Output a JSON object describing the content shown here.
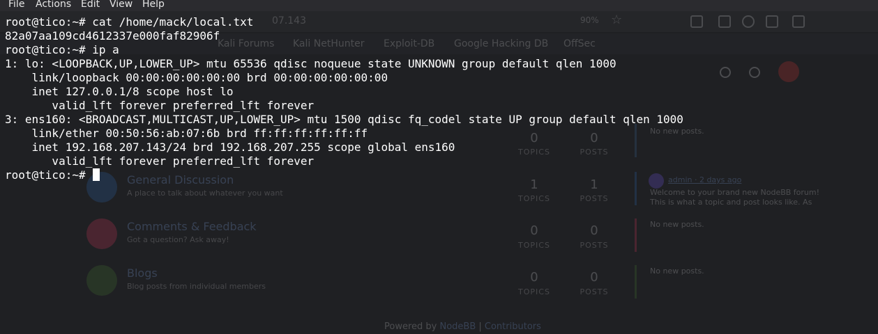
{
  "menu": [
    "File",
    "Actions",
    "Edit",
    "View",
    "Help"
  ],
  "terminal": {
    "lines": [
      "root@tico:~# cat /home/mack/local.txt",
      "82a07aa109cd4612337e000faf82906f",
      "root@tico:~# ip a",
      "1: lo: <LOOPBACK,UP,LOWER_UP> mtu 65536 qdisc noqueue state UNKNOWN group default qlen 1000",
      "    link/loopback 00:00:00:00:00:00 brd 00:00:00:00:00:00",
      "    inet 127.0.0.1/8 scope host lo",
      "       valid_lft forever preferred_lft forever",
      "3: ens160: <BROADCAST,MULTICAST,UP,LOWER_UP> mtu 1500 qdisc fq_codel state UP group default qlen 1000",
      "    link/ether 00:50:56:ab:07:6b brd ff:ff:ff:ff:ff:ff",
      "    inet 192.168.207.143/24 brd 192.168.207.255 scope global ens160",
      "       valid_lft forever preferred_lft forever"
    ],
    "prompt": "root@tico:~# "
  },
  "background": {
    "url_fragment": "07.143",
    "zoom": "90%",
    "bookmarks": [
      "Kali Forums",
      "Kali NetHunter",
      "Exploit-DB",
      "Google Hacking DB",
      "OffSec"
    ],
    "categories": [
      {
        "title": "",
        "desc": "",
        "topics": "0",
        "posts": "0",
        "color": "#3b6ea5",
        "last": "No new posts."
      },
      {
        "title": "General Discussion",
        "desc": "A place to talk about whatever you want",
        "topics": "1",
        "posts": "1",
        "color": "#2f6fbf",
        "last": ""
      },
      {
        "title": "Comments & Feedback",
        "desc": "Got a question? Ask away!",
        "topics": "0",
        "posts": "0",
        "color": "#e23a5e",
        "last": "No new posts."
      },
      {
        "title": "Blogs",
        "desc": "Blog posts from individual members",
        "topics": "0",
        "posts": "0",
        "color": "#4a7f33",
        "last": "No new posts."
      }
    ],
    "topics_label": "TOPICS",
    "posts_label": "POSTS",
    "recent_post": {
      "meta": "admin · 2 days ago",
      "text": [
        "Welcome to your brand new NodeBB forum!",
        "This is what a topic and post looks like. As"
      ]
    },
    "footer_prefix": "Powered by ",
    "footer_link1": "NodeBB",
    "footer_sep": " | ",
    "footer_link2": "Contributors"
  },
  "colors": {
    "terminal_bg": "#1f2023",
    "text": "#ffffff"
  }
}
